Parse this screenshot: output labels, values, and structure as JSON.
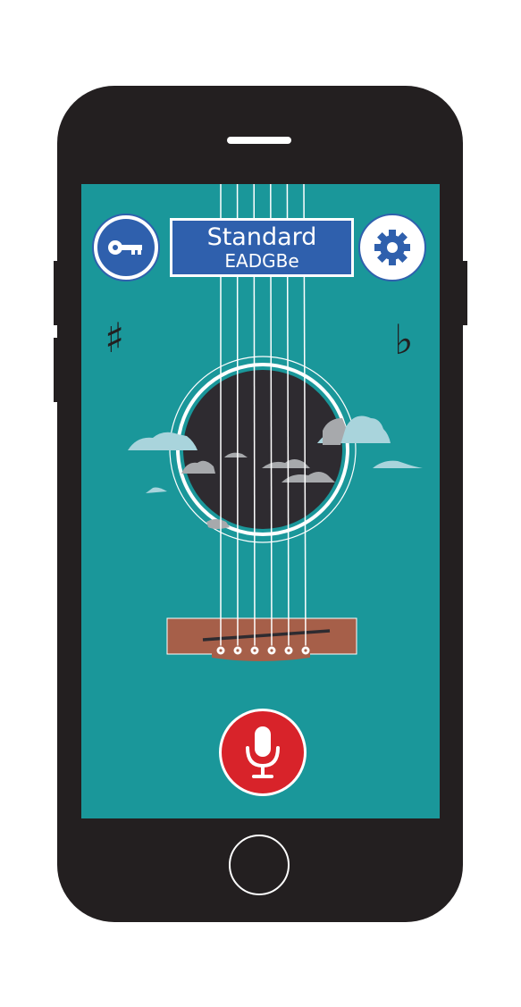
{
  "colors": {
    "screen_bg": "#1a979a",
    "accent_blue": "#2f60ad",
    "mic_red": "#d8232a",
    "soundhole": "#2e2b30",
    "bridge": "#a65f49",
    "cloud": "#a9d4dc",
    "frame": "#231f20"
  },
  "header": {
    "tuning_name": "Standard",
    "tuning_notes": "EADGBe",
    "left_icon": "key-icon",
    "right_icon": "gear-icon"
  },
  "accidentals": {
    "sharp": "♯",
    "flat": "♭"
  },
  "guitar": {
    "string_count": 6
  },
  "actions": {
    "mic_icon": "microphone-icon"
  }
}
